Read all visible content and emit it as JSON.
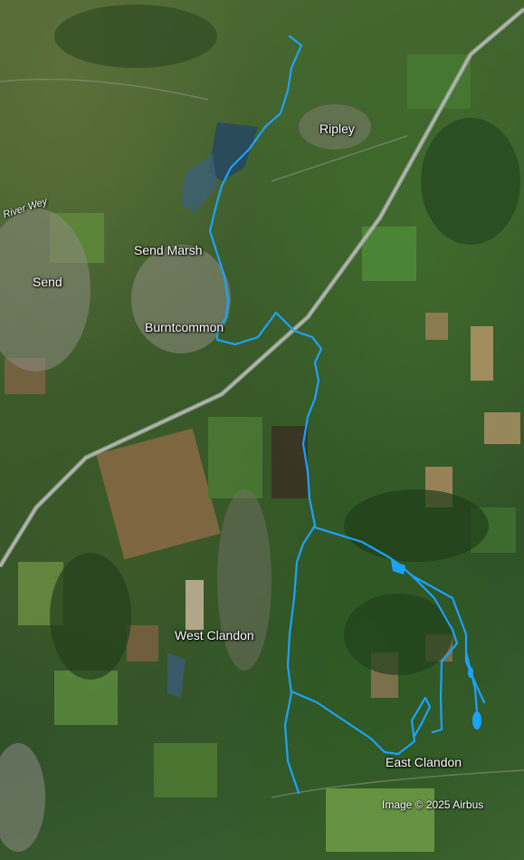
{
  "map": {
    "places": {
      "ripley": "Ripley",
      "send_marsh": "Send Marsh",
      "send": "Send",
      "burntcommon": "Burntcommon",
      "west_clandon": "West Clandon",
      "east_clandon": "East Clandon"
    },
    "river_label": "River Wey",
    "imagery_credit": "Image © 2025 Airbus",
    "route_color": "#1aa3ff",
    "road_color": "#9aa39a",
    "water_color": "#27485f"
  }
}
